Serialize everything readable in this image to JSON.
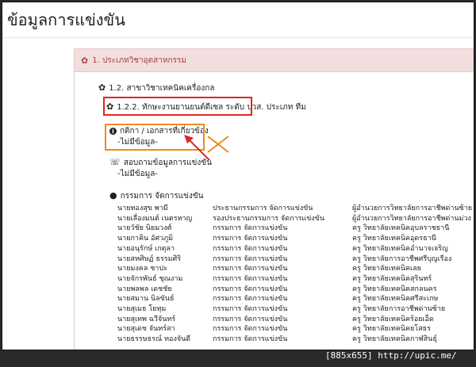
{
  "page": {
    "title": "ข้อมูลการแข่งขัน"
  },
  "panel": {
    "heading": "1. ประเภทวิชาอุตสาหกรรม",
    "subheading": "1.2. สาขาวิชาเทคนิคเครื่องกล",
    "item": "1.2.2. ทักษะงานยานยนต์ดีเซล ระดับ ปวส. ประเภท ทีม",
    "references": {
      "label": "กติกา / เอกสารที่เกี่ยวข้อง",
      "value": "-ไม่มีข้อมูล-"
    },
    "questions": {
      "label": "สอบถามข้อมูลการแข่งขัน",
      "value": "-ไม่มีข้อมูล-"
    },
    "committee": {
      "label": "กรรมการ จัดการแข่งขัน",
      "rows": [
        [
          "นายทองสุข พามี",
          "ประธานกรรมการ จัดการแข่งขัน",
          "ผู้อำนวยการวิทยาลัยการอาชีพด่านซ้าย"
        ],
        [
          "นายเลื่องมนต์ เนตรหาญ",
          "รองประธานกรรมการ จัดการแข่งขัน",
          "ผู้อำนวยการวิทยาลัยการอาชีพด่านม่วง"
        ],
        [
          "นายวัชัย นิยมวงศ์",
          "กรรมการ จัดการแข่งขัน",
          "ครู วิทยาลัยเทคนิคอุบลราชธานี"
        ],
        [
          "นายกาคิน อัศวภูมิ",
          "กรรมการ จัดการแข่งขัน",
          "ครู วิทยาลัยเทคนิคอุดรธานี"
        ],
        [
          "นายอนุรักษ์ เกตุลา",
          "กรรมการ จัดการแข่งขัน",
          "ครู วิทยาลัยเทคนิคอำนาจเจริญ"
        ],
        [
          "นายสหศิษฏ์ ธรรมศิริ",
          "กรรมการ จัดการแข่งขัน",
          "ครู วิทยาลัยการอาชีพศรีบุญเรือง"
        ],
        [
          "นายมงคล ชาปะ",
          "กรรมการ จัดการแข่งขัน",
          "ครู วิทยาลัยเทคนิคเลย"
        ],
        [
          "นายจักรพันธ์ ชุณงาม",
          "กรรมการ จัดการแข่งขัน",
          "ครู วิทยาลัยเทคนิคสุรินทร์"
        ],
        [
          "นายพลพล เดชชัย",
          "กรรมการ จัดการแข่งขัน",
          "ครู วิทยาลัยเทคนิคสกลนคร"
        ],
        [
          "นายสมาน นิลขันธ์",
          "กรรมการ จัดการแข่งขัน",
          "ครู วิทยาลัยเทคนิคศรีสะเกษ"
        ],
        [
          "นายสุเมธ โยทุม",
          "กรรมการ จัดการแข่งขัน",
          "ครู วิทยาลัยการอาชีพด่านซ้าย"
        ],
        [
          "นายสุเทพ ฉวีจันทร์",
          "กรรมการ จัดการแข่งขัน",
          "ครู วิทยาลัยเทคนิคร้อยเอ็ด"
        ],
        [
          "นายสุเดช จันทร์สา",
          "กรรมการ จัดการแข่งขัน",
          "ครู วิทยาลัยเทคนิคยโสธร"
        ],
        [
          "นายธรรษธรณ์ ทองจันดี",
          "กรรมการ จัดการแข่งขัน",
          "ครู วิทยาลัยเทคนิคกาฬสินธุ์"
        ]
      ]
    }
  },
  "footer": {
    "text": "[885x655] http://upic.me/"
  },
  "colors": {
    "panel_heading_bg": "#f2dede",
    "panel_heading_text": "#a94442",
    "highlight_red": "#e0261f",
    "highlight_orange": "#f08a1c"
  }
}
